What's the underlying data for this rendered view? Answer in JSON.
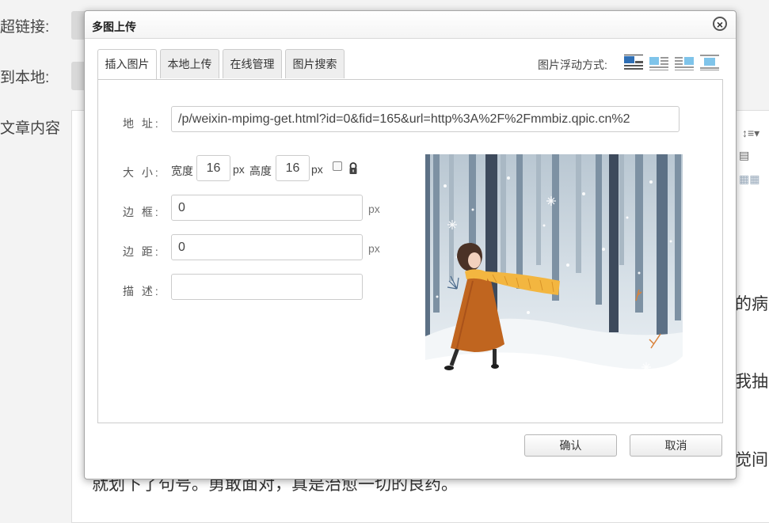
{
  "background": {
    "labels": [
      "超链接:",
      "到本地:",
      "文章内容"
    ],
    "right_text": [
      "的病",
      "我抽",
      "觉间"
    ],
    "bottom_text": "就划下了句号。勇敢面对，真是治愈一切的良药。"
  },
  "dialog": {
    "title": "多图上传",
    "close_symbol": "×",
    "tabs": [
      {
        "label": "插入图片",
        "active": true
      },
      {
        "label": "本地上传",
        "active": false
      },
      {
        "label": "在线管理",
        "active": false
      },
      {
        "label": "图片搜索",
        "active": false
      }
    ],
    "float_label": "图片浮动方式:",
    "float_options": [
      "none-float-icon",
      "left-float-icon",
      "right-float-icon",
      "center-float-icon"
    ],
    "form": {
      "address_label": "地 址:",
      "address_value": "/p/weixin-mpimg-get.html?id=0&fid=165&url=http%3A%2F%2Fmmbiz.qpic.cn%2",
      "size_label": "大 小:",
      "width_label": "宽度",
      "width_value": "16",
      "height_label": "高度",
      "height_value": "16",
      "px": "px",
      "border_label": "边 框:",
      "border_value": "0",
      "margin_label": "边 距:",
      "margin_value": "0",
      "desc_label": "描 述:",
      "desc_value": ""
    },
    "buttons": {
      "confirm": "确认",
      "cancel": "取消"
    }
  }
}
